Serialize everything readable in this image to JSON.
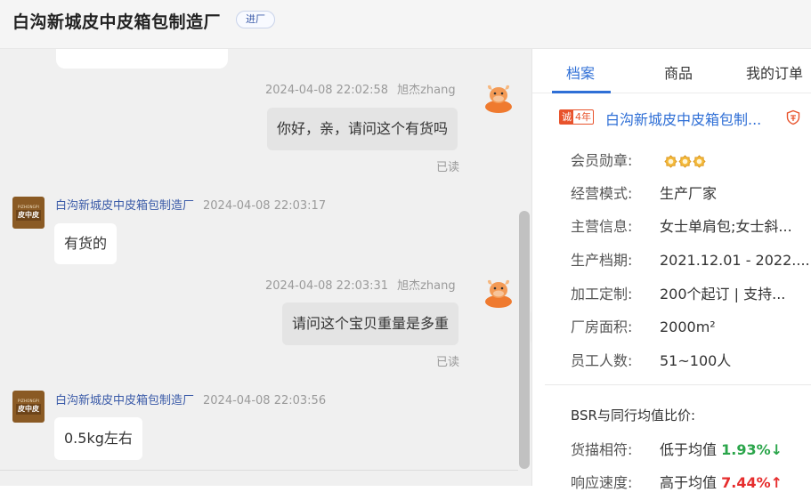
{
  "header": {
    "title": "白沟新城皮中皮箱包制造厂",
    "tag": "进厂"
  },
  "chat": {
    "messages": [
      {
        "sender": "旭杰zhang",
        "time": "2024-04-08 22:02:58",
        "text": "你好，亲，请问这个有货吗",
        "status": "已读",
        "mine": true
      },
      {
        "sender": "白沟新城皮中皮箱包制造厂",
        "time": "2024-04-08 22:03:17",
        "text": "有货的",
        "mine": false
      },
      {
        "sender": "旭杰zhang",
        "time": "2024-04-08 22:03:31",
        "text": "请问这个宝贝重量是多重",
        "status": "已读",
        "mine": true
      },
      {
        "sender": "白沟新城皮中皮箱包制造厂",
        "time": "2024-04-08 22:03:56",
        "text": "0.5kg左右",
        "mine": false
      }
    ],
    "shop_avatar": {
      "small_text": "PIZHONGPI",
      "big_text": "皮中皮"
    },
    "collapse_icon": "»"
  },
  "panel": {
    "tabs": [
      "档案",
      "商品",
      "我的订单"
    ],
    "active_tab": 0,
    "badge": {
      "part1": "诚",
      "part2": "4年"
    },
    "shop_name": "白沟新城皮中皮箱包制...",
    "info": [
      {
        "label": "会员勋章:",
        "value": ""
      },
      {
        "label": "经营模式:",
        "value": "生产厂家"
      },
      {
        "label": "主营信息:",
        "value": "女士单肩包;女士斜..."
      },
      {
        "label": "生产档期:",
        "value": "2021.12.01 - 2022...."
      },
      {
        "label": "加工定制:",
        "value": "200个起订 | 支持..."
      },
      {
        "label": "厂房面积:",
        "value": "2000m²"
      },
      {
        "label": "员工人数:",
        "value": "51~100人"
      }
    ],
    "bsr": {
      "title": "BSR与同行均值比价:",
      "rows": [
        {
          "label": "货描相符:",
          "value": "低于均值",
          "pct": "1.93%↓"
        },
        {
          "label": "响应速度:",
          "value": "高于均值",
          "pct": "7.44%↑"
        }
      ]
    }
  },
  "colors": {
    "accent": "#2f6fd6",
    "down": "#2aa54a",
    "up": "#e62d2d",
    "badge": "#e8532c"
  }
}
